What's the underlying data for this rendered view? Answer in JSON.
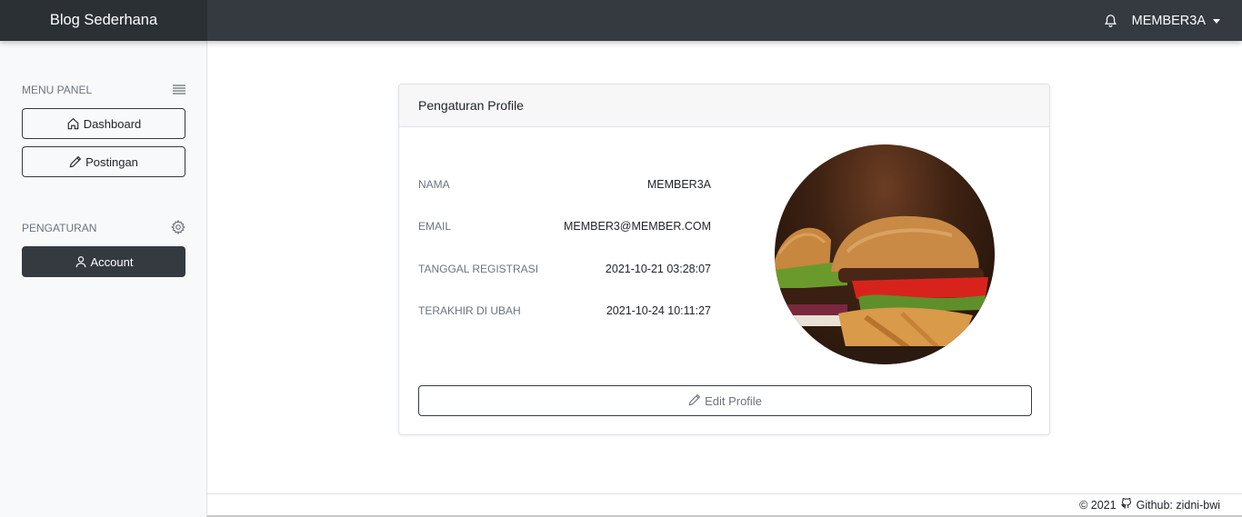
{
  "navbar": {
    "brand": "Blog Sederhana",
    "user": "MEMBER3A",
    "icons": [
      "bell-icon",
      "caret-down-icon"
    ]
  },
  "sidebar": {
    "menu_panel": {
      "title": "MENU PANEL",
      "icon": "hamburger-icon",
      "items": [
        {
          "label": "Dashboard",
          "icon": "home-icon"
        },
        {
          "label": "Postingan",
          "icon": "pencil-icon"
        }
      ]
    },
    "settings": {
      "title": "PENGATURAN",
      "icon": "gear-icon",
      "items": [
        {
          "label": "Account",
          "icon": "user-icon",
          "active": true
        }
      ]
    }
  },
  "profile_card": {
    "title": "Pengaturan Profile",
    "fields": [
      {
        "label": "NAMA",
        "value": "MEMBER3A"
      },
      {
        "label": "EMAIL",
        "value": "MEMBER3@MEMBER.COM"
      },
      {
        "label": "TANGGAL REGISTRASI",
        "value": "2021-10-21 03:28:07"
      },
      {
        "label": "TERAKHIR DI UBAH",
        "value": "2021-10-24 10:11:27"
      }
    ],
    "avatar_alt": "burger-photo",
    "edit_label": "Edit Profile"
  },
  "footer": {
    "copyright": "© 2021",
    "github_label": "Github: zidni-bwi"
  },
  "colors": {
    "navbar": "#343a40",
    "brand_bg": "#2b3035",
    "sidebar_bg": "#f8f9fa",
    "active_button": "#343a40"
  }
}
